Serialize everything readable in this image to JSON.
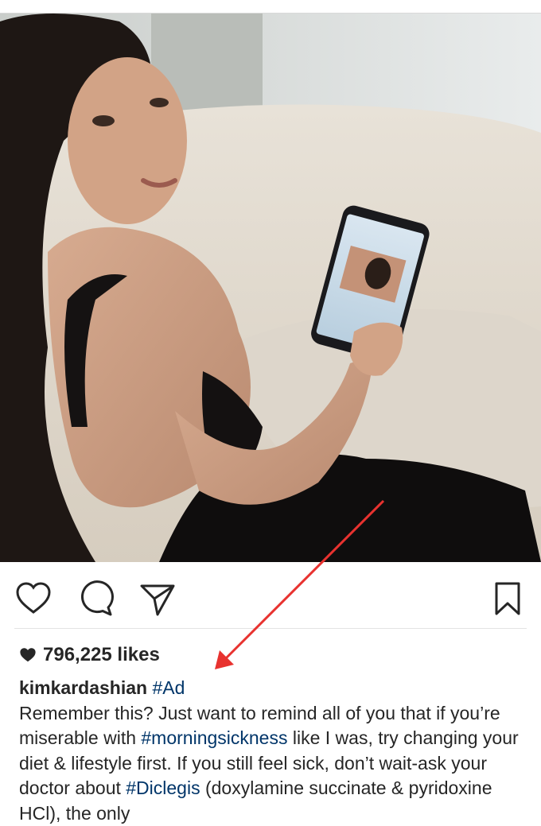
{
  "post": {
    "likes": "796,225 likes",
    "username": "kimkardashian",
    "tag_ad": "#Ad",
    "caption_1": "Remember this? Just want to remind all of you that if you’re miserable with ",
    "tag_morningsickness": "#morningsickness",
    "caption_2": " like I was, try changing your diet & lifestyle first. If you still feel sick, don’t wait-ask your doctor about ",
    "tag_diclegis": "#Diclegis",
    "caption_3": " (doxylamine succinate & pyridoxine HCl), the only"
  },
  "icons": {
    "like": "heart-outline-icon",
    "comment": "speech-bubble-icon",
    "share": "paper-plane-icon",
    "save": "bookmark-icon",
    "likes_count": "heart-filled-icon"
  },
  "colors": {
    "text": "#262626",
    "hashtag": "#003569",
    "annotation_arrow": "#e8322f"
  }
}
